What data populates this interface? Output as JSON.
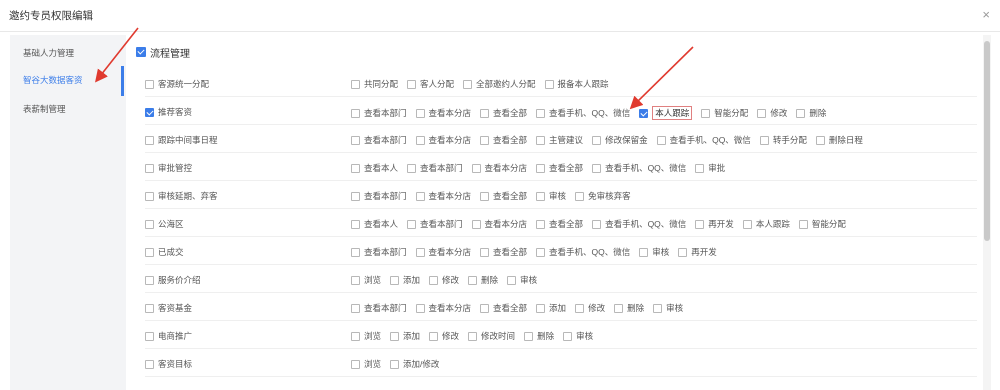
{
  "dialog": {
    "title": "邀约专员权限编辑",
    "close_label": "×"
  },
  "sidebar": {
    "items": [
      {
        "label": "基础人力管理"
      },
      {
        "label": "智谷大数据客资"
      },
      {
        "label": "表薪制管理"
      }
    ],
    "active_index": 1
  },
  "main": {
    "header_label": "流程管理",
    "header_checked": true,
    "rows": [
      {
        "name": "客源统一分配",
        "checked": false,
        "options": [
          {
            "label": "共同分配",
            "checked": false
          },
          {
            "label": "客人分配",
            "checked": false
          },
          {
            "label": "全部邀约人分配",
            "checked": false
          },
          {
            "label": "报备本人跟踪",
            "checked": false
          }
        ]
      },
      {
        "name": "推荐客资",
        "checked": true,
        "options": [
          {
            "label": "查看本部门",
            "checked": false
          },
          {
            "label": "查看本分店",
            "checked": false
          },
          {
            "label": "查看全部",
            "checked": false
          },
          {
            "label": "查看手机、QQ、微信",
            "checked": false
          },
          {
            "label": "本人跟踪",
            "checked": true,
            "highlight": true
          },
          {
            "label": "智能分配",
            "checked": false
          },
          {
            "label": "修改",
            "checked": false
          },
          {
            "label": "删除",
            "checked": false
          }
        ]
      },
      {
        "name": "跟踪中间事日程",
        "checked": false,
        "options": [
          {
            "label": "查看本部门",
            "checked": false
          },
          {
            "label": "查看本分店",
            "checked": false
          },
          {
            "label": "查看全部",
            "checked": false
          },
          {
            "label": "主管建议",
            "checked": false
          },
          {
            "label": "修改保留金",
            "checked": false
          },
          {
            "label": "查看手机、QQ、微信",
            "checked": false
          },
          {
            "label": "转手分配",
            "checked": false
          },
          {
            "label": "删除日程",
            "checked": false
          }
        ]
      },
      {
        "name": "审批管控",
        "checked": false,
        "options": [
          {
            "label": "查看本人",
            "checked": false
          },
          {
            "label": "查看本部门",
            "checked": false
          },
          {
            "label": "查看本分店",
            "checked": false
          },
          {
            "label": "查看全部",
            "checked": false
          },
          {
            "label": "查看手机、QQ、微信",
            "checked": false
          },
          {
            "label": "审批",
            "checked": false
          }
        ]
      },
      {
        "name": "审核延期、弃客",
        "checked": false,
        "options": [
          {
            "label": "查看本部门",
            "checked": false
          },
          {
            "label": "查看本分店",
            "checked": false
          },
          {
            "label": "查看全部",
            "checked": false
          },
          {
            "label": "审核",
            "checked": false
          },
          {
            "label": "免审核弃客",
            "checked": false
          }
        ]
      },
      {
        "name": "公海区",
        "checked": false,
        "options": [
          {
            "label": "查看本人",
            "checked": false
          },
          {
            "label": "查看本部门",
            "checked": false
          },
          {
            "label": "查看本分店",
            "checked": false
          },
          {
            "label": "查看全部",
            "checked": false
          },
          {
            "label": "查看手机、QQ、微信",
            "checked": false
          },
          {
            "label": "再开发",
            "checked": false
          },
          {
            "label": "本人跟踪",
            "checked": false
          },
          {
            "label": "智能分配",
            "checked": false
          }
        ]
      },
      {
        "name": "已成交",
        "checked": false,
        "options": [
          {
            "label": "查看本部门",
            "checked": false
          },
          {
            "label": "查看本分店",
            "checked": false
          },
          {
            "label": "查看全部",
            "checked": false
          },
          {
            "label": "查看手机、QQ、微信",
            "checked": false
          },
          {
            "label": "审核",
            "checked": false
          },
          {
            "label": "再开发",
            "checked": false
          }
        ]
      },
      {
        "name": "服务价介绍",
        "checked": false,
        "options": [
          {
            "label": "浏览",
            "checked": false
          },
          {
            "label": "添加",
            "checked": false
          },
          {
            "label": "修改",
            "checked": false
          },
          {
            "label": "删除",
            "checked": false
          },
          {
            "label": "审核",
            "checked": false
          }
        ]
      },
      {
        "name": "客资基金",
        "checked": false,
        "options": [
          {
            "label": "查看本部门",
            "checked": false
          },
          {
            "label": "查看本分店",
            "checked": false
          },
          {
            "label": "查看全部",
            "checked": false
          },
          {
            "label": "添加",
            "checked": false
          },
          {
            "label": "修改",
            "checked": false
          },
          {
            "label": "删除",
            "checked": false
          },
          {
            "label": "审核",
            "checked": false
          }
        ]
      },
      {
        "name": "电商推广",
        "checked": false,
        "options": [
          {
            "label": "浏览",
            "checked": false
          },
          {
            "label": "添加",
            "checked": false
          },
          {
            "label": "修改",
            "checked": false
          },
          {
            "label": "修改时间",
            "checked": false
          },
          {
            "label": "删除",
            "checked": false
          },
          {
            "label": "审核",
            "checked": false
          }
        ]
      },
      {
        "name": "客资目标",
        "checked": false,
        "options": [
          {
            "label": "浏览",
            "checked": false
          },
          {
            "label": "添加/修改",
            "checked": false
          }
        ]
      }
    ]
  },
  "colors": {
    "accent": "#3b7de9",
    "annotation_arrow": "#e03a2f"
  }
}
